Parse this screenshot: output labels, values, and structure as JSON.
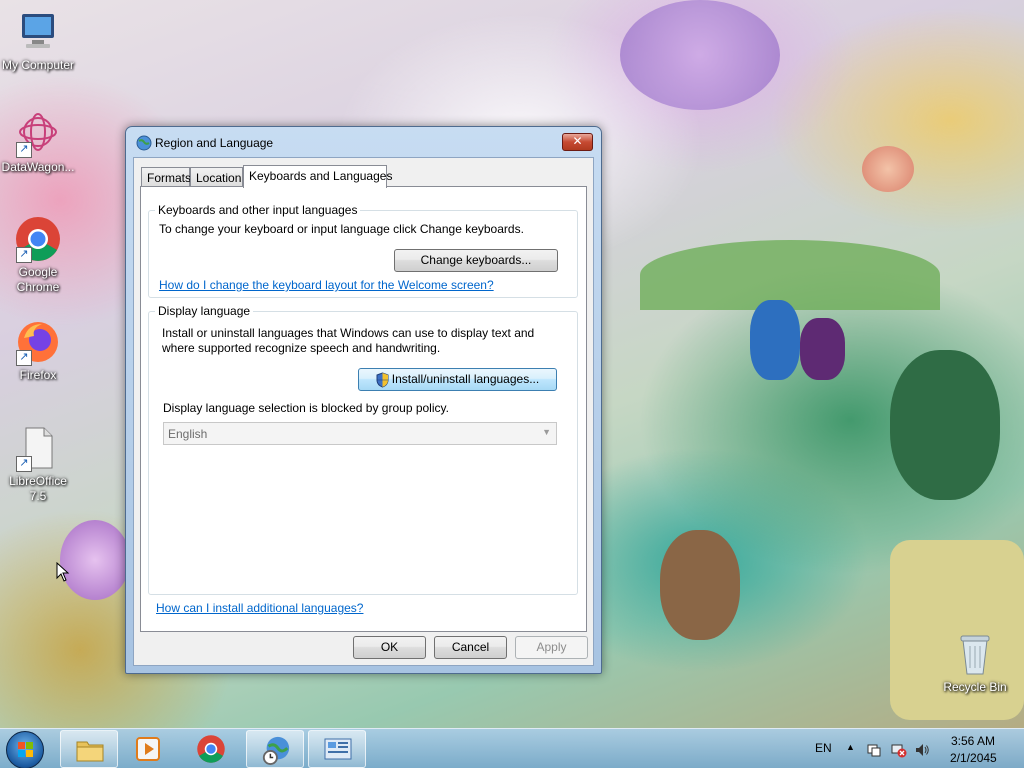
{
  "desktop": {
    "icons": [
      {
        "label": "My Computer"
      },
      {
        "label": "DataWagon..."
      },
      {
        "label": "Google Chrome"
      },
      {
        "label": "Firefox"
      },
      {
        "label": "LibreOffice 7.5"
      },
      {
        "label": "Recycle Bin"
      }
    ]
  },
  "window": {
    "title": "Region and Language",
    "close_label": "✕",
    "tabs": [
      "Formats",
      "Location",
      "Keyboards and Languages"
    ],
    "active_tab": "Keyboards and Languages",
    "keyboards_group": {
      "title": "Keyboards and other input languages",
      "description": "To change your keyboard or input language click Change keyboards.",
      "button": "Change keyboards...",
      "link": "How do I change the keyboard layout for the Welcome screen?"
    },
    "display_group": {
      "title": "Display language",
      "description_line1": "Install or uninstall languages that Windows can use to display text and",
      "description_line2": "where supported recognize speech and handwriting.",
      "button": "Install/uninstall languages...",
      "policy_note": "Display language selection is blocked by group policy.",
      "language_select_value": "English"
    },
    "bottom_link": "How can I install additional languages?",
    "buttons": {
      "ok": "OK",
      "cancel": "Cancel",
      "apply": "Apply"
    }
  },
  "taskbar": {
    "language": "EN",
    "time": "3:56 AM",
    "date": "2/1/2045"
  },
  "colors": {
    "link": "#0066cc",
    "close_button": "#c64a32",
    "taskbar": "#8fbcd9"
  }
}
